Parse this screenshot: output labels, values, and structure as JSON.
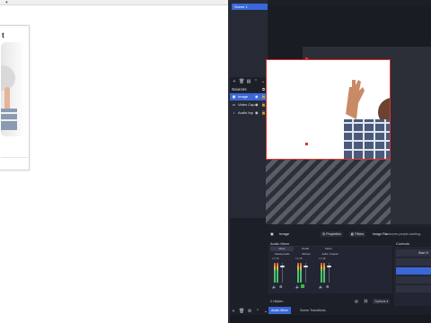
{
  "browser": {
    "card_title": "t"
  },
  "obs": {
    "scenes": {
      "items": [
        {
          "label": "Scene 1"
        }
      ]
    },
    "sources": {
      "header": "Sources",
      "items": [
        {
          "label": "Image",
          "icon": "image-icon",
          "selected": true
        },
        {
          "label": "Video Cap",
          "icon": "camera-icon",
          "selected": false
        },
        {
          "label": "Audio Inp",
          "icon": "mic-icon",
          "selected": false
        }
      ]
    },
    "properties_bar": {
      "source_name": "Image",
      "properties_label": "Properties",
      "filters_label": "Filters",
      "image_file_label": "Image File",
      "image_file_value": "welcome-people-starting-"
    },
    "audio_mixer": {
      "title": "Audio Mixer",
      "tabs": [
        "Mixer",
        "Detail",
        "Meter"
      ],
      "channels": [
        {
          "name": "Desktop Audio",
          "db": "0.0 dB",
          "level": 0.15
        },
        {
          "name": "Mic/Aux",
          "db": "0.0 dB",
          "level": 0.15
        },
        {
          "name": "Audio • Capture",
          "db": "0.0 dB",
          "level": 0.15
        }
      ],
      "footer_count": "0 Hidden",
      "options_label": "Options"
    },
    "controls": {
      "title": "Controls",
      "buttons": [
        {
          "label": "Start S",
          "highlighted": false
        },
        {
          "label": "",
          "highlighted": false
        },
        {
          "label": "",
          "highlighted": true
        },
        {
          "label": "",
          "highlighted": false
        },
        {
          "label": "",
          "highlighted": false
        }
      ]
    },
    "bottom_tabs": [
      {
        "label": "Audio Mixer",
        "active": true
      },
      {
        "label": "Scene Transitions",
        "active": false
      }
    ]
  },
  "colors": {
    "accent": "#3a68d9",
    "selection_border": "#e0322e",
    "obs_background": "#1d1f28"
  }
}
